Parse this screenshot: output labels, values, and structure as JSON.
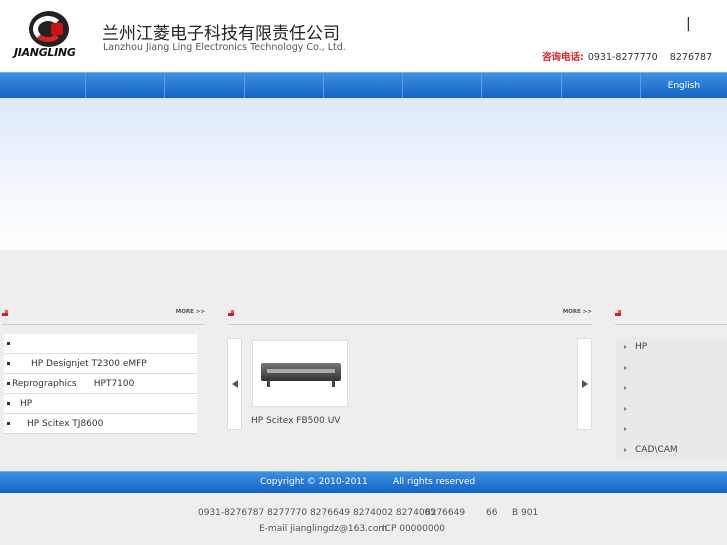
{
  "header": {
    "logo_text": "JIANGLING",
    "company_cn": "兰州江菱电子科技有限责任公司",
    "company_en": "Lanzhou Jiang Ling Electronics Technology Co., Ltd.",
    "lang_divider": "|",
    "hotline_label": "咨询电话:",
    "hotline_numbers": "0931-8277770    8276787"
  },
  "nav": {
    "items": [
      "",
      "",
      "",
      "",
      "",
      "",
      "",
      ""
    ],
    "english": "English"
  },
  "left_column": {
    "more": "MORE >>",
    "items": [
      "",
      "HP Designjet T2300 eMFP",
      "Reprographics      HPT7100",
      "HP",
      "HP Scitex TJ8600"
    ]
  },
  "middle_column": {
    "more": "MORE >>",
    "product_caption": "HP Scitex FB500 UV"
  },
  "right_column": {
    "items": [
      "HP",
      "",
      "",
      "",
      "",
      "CAD\\CAM"
    ]
  },
  "footer": {
    "copyright": "Copyright © 2010-2011",
    "rights": "All rights reserved",
    "phones": "0931-8276787 8277770 8276649 8274002 8274005",
    "fax": "8276649",
    "room_a": "66",
    "room_b": "B 901",
    "email": "E-mail jianglingdz@163.com",
    "icp": "ICP 00000000"
  },
  "colors": {
    "nav_blue": "#1f74d4",
    "hotline_red": "#dd2222",
    "accent_red": "#cc2222"
  }
}
